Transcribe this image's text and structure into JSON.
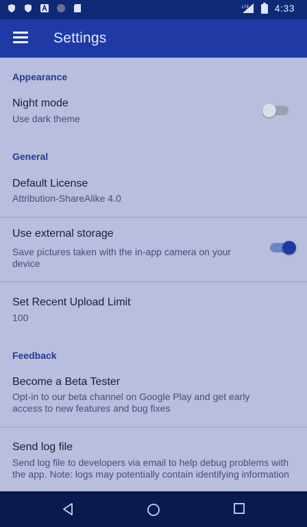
{
  "status_bar": {
    "time": "4:33",
    "network": "LTE"
  },
  "app_bar": {
    "title": "Settings"
  },
  "sections": {
    "appearance": {
      "header": "Appearance",
      "night_mode": {
        "title": "Night mode",
        "summary": "Use dark theme",
        "enabled": false
      }
    },
    "general": {
      "header": "General",
      "default_license": {
        "title": "Default License",
        "summary": "Attribution-ShareAlike 4.0"
      },
      "external_storage": {
        "title": "Use external storage",
        "summary": "Save pictures taken with the in-app camera on your device",
        "enabled": true
      },
      "upload_limit": {
        "title": "Set Recent Upload Limit",
        "summary": "100"
      }
    },
    "feedback": {
      "header": "Feedback",
      "beta_tester": {
        "title": "Become a Beta Tester",
        "summary": "Opt-in to our beta channel on Google Play and get early access to new features and bug fixes"
      },
      "send_log": {
        "title": "Send log file",
        "summary": "Send log file to developers via email to help debug problems with the app. Note: logs may potentially contain identifying information"
      }
    }
  },
  "colors": {
    "primary": "#1f3aa5",
    "status_bar": "#0e2a76",
    "accent": "#1f3aa5"
  },
  "icons": {
    "menu": "hamburger-menu-icon",
    "back": "back-triangle-icon",
    "home": "home-circle-icon",
    "recent": "recent-square-icon"
  }
}
